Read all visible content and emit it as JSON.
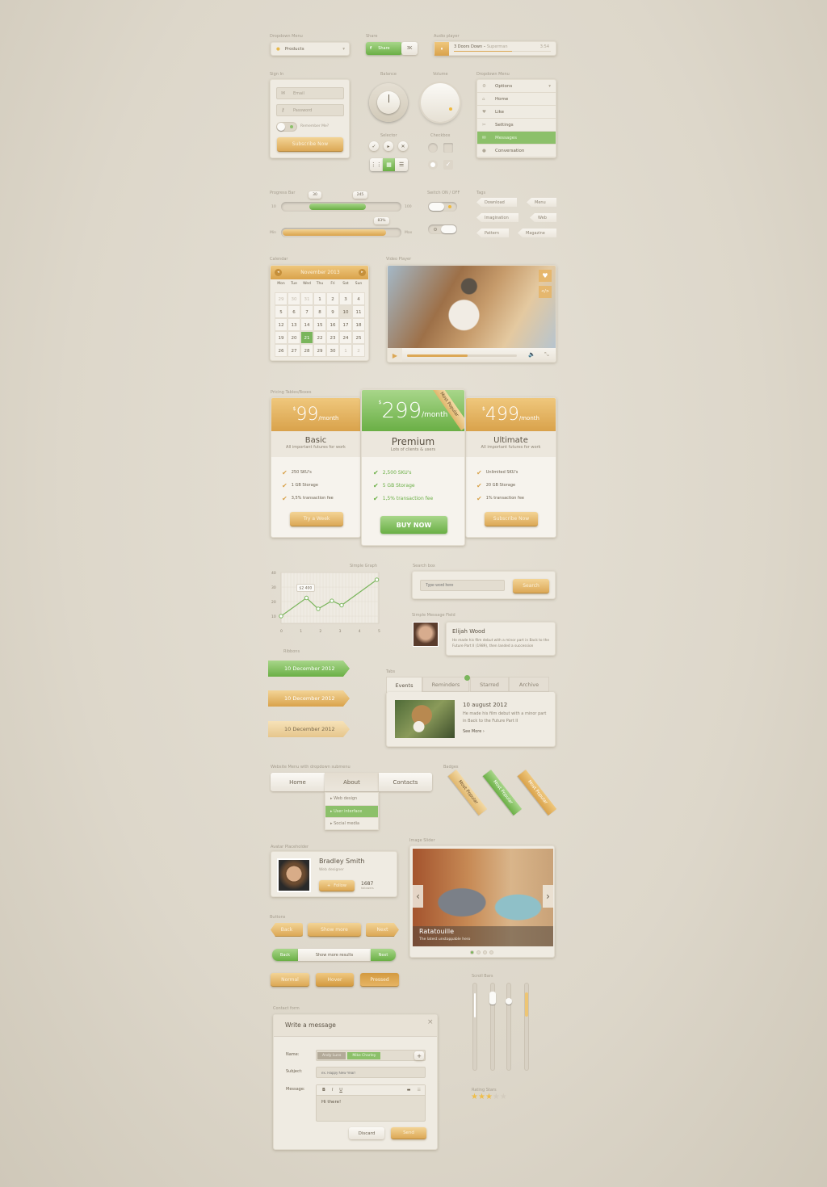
{
  "labels": {
    "dropdown1": "Dropdown Menu",
    "share": "Share",
    "audio": "Audio player",
    "signin": "Sign In",
    "balance": "Balance",
    "volume": "Volume",
    "selector": "Selector",
    "checkbox": "Checkbox",
    "dropdown2": "Dropdown Menu",
    "progress": "Progress Bar",
    "switch": "Switch ON / OFF",
    "tags": "Tags",
    "calendar": "Calendar",
    "video": "Video Player",
    "pricing": "Pricing Tables/Boxes",
    "graph": "Simple Graph",
    "search": "Search box",
    "message": "Simple Message Field",
    "ribbons": "Ribbons",
    "tabs": "Tabs",
    "webmenu": "Website Menu with dropdown submenu",
    "badges": "Badges",
    "avatar": "Avatar Placeholder",
    "slider": "Image Slider",
    "buttons": "Buttons",
    "scrollbars": "Scroll Bars",
    "rating": "Rating Stars",
    "contact": "Contact form"
  },
  "dropdown1": {
    "value": "Products"
  },
  "share": {
    "label": "Share",
    "count": "3K"
  },
  "audio": {
    "artist": "3 Doors Down –",
    "track": "Superman",
    "time": "3:54",
    "progress": 0.6
  },
  "signin": {
    "email_placeholder": "Email",
    "password_placeholder": "Password",
    "remember": "Remember Me?",
    "submit": "Subscribe Now"
  },
  "dropdown2": {
    "items": [
      {
        "label": "Options",
        "icon": "gear-icon"
      },
      {
        "label": "Home",
        "icon": "home-icon"
      },
      {
        "label": "Like",
        "icon": "heart-icon"
      },
      {
        "label": "Settings",
        "icon": "wrench-icon"
      },
      {
        "label": "Messages",
        "icon": "envelope-icon",
        "active": true
      },
      {
        "label": "Conversation",
        "icon": "chat-icon"
      }
    ]
  },
  "progress": {
    "slider": {
      "min": "10",
      "max": "100",
      "low": "30",
      "high": "245"
    },
    "bar": {
      "min": "Min",
      "max": "Max",
      "value": "83%"
    }
  },
  "tags": [
    "Download",
    "Menu",
    "Imagination",
    "Web",
    "Pattern",
    "Magazine"
  ],
  "calendar": {
    "title": "November 2013",
    "days": [
      "Mon",
      "Tue",
      "Wed",
      "Thu",
      "Fri",
      "Sat",
      "Sun"
    ],
    "cells": [
      "29",
      "30",
      "31",
      "1",
      "2",
      "3",
      "4",
      "5",
      "6",
      "7",
      "8",
      "9",
      "10",
      "11",
      "12",
      "13",
      "14",
      "15",
      "16",
      "17",
      "18",
      "19",
      "20",
      "21",
      "22",
      "23",
      "24",
      "25",
      "26",
      "27",
      "28",
      "29",
      "30",
      "1",
      "2"
    ],
    "selected": "21",
    "today": "10"
  },
  "video": {
    "progress": 0.55
  },
  "pricing": [
    {
      "currency": "$",
      "price": "99",
      "period": "/month",
      "name": "Basic",
      "desc": "All important futures for work",
      "features": [
        "250 SKU's",
        "1 GB Storage",
        "3,5% transaction fee"
      ],
      "button": "Try a Week"
    },
    {
      "currency": "$",
      "price": "299",
      "period": "/month",
      "name": "Premium",
      "desc": "Lots of clients & users",
      "features": [
        "2,500 SKU's",
        "5 GB Storage",
        "1,5% transaction fee"
      ],
      "button": "BUY NOW",
      "badge": "Most Popular"
    },
    {
      "currency": "$",
      "price": "499",
      "period": "/month",
      "name": "Ultimate",
      "desc": "All important futures for work",
      "features": [
        "Unlimited SKU's",
        "20 GB Storage",
        "1% transaction fee"
      ],
      "button": "Subscribe Now"
    }
  ],
  "chart_data": {
    "type": "line",
    "title": "Simple Graph",
    "x": [
      0,
      1.3,
      1.9,
      2.6,
      3.1,
      4.9
    ],
    "y": [
      10,
      22.5,
      15,
      20.5,
      17.5,
      35
    ],
    "xticks": [
      "0",
      "1",
      "2",
      "3",
      "4",
      "5"
    ],
    "yticks": [
      "40",
      "30",
      "20",
      "10"
    ],
    "xlim": [
      0,
      5
    ],
    "ylim": [
      5,
      40
    ],
    "annotation": {
      "text": "$2 400",
      "point": 1
    },
    "grid": true,
    "color": "#7ab55c"
  },
  "search": {
    "placeholder": "Type word here",
    "button": "Search"
  },
  "message": {
    "name": "Elijah Wood",
    "text": "He made his film debut with a minor part in Back to the Future Part II (1989), then landed a succession"
  },
  "ribbons": [
    "10 December 2012",
    "10 December 2012",
    "10 December 2012"
  ],
  "tabs": {
    "items": [
      "Events",
      "Reminders",
      "Starred",
      "Archive"
    ],
    "active": 0,
    "title": "10 august 2012",
    "text": "He made his film debut with a minor part in Back to the Future Part II",
    "more": "See More"
  },
  "webmenu": {
    "items": [
      "Home",
      "About",
      "Contacts"
    ],
    "submenu": [
      "Web design",
      "User interface",
      "Social media"
    ],
    "active_sub": 1
  },
  "badges": [
    "Most Popular",
    "Most Popular",
    "Most Popular"
  ],
  "avatar": {
    "name": "Bradley Smith",
    "role": "Web designer",
    "follow": "Follow",
    "count": "1687",
    "count_label": "followers"
  },
  "slider": {
    "title": "Ratatouille",
    "subtitle": "The latest unstoppable hero",
    "slides": 4,
    "active": 0
  },
  "buttons": {
    "back": "Back",
    "more": "Show more",
    "next": "Next",
    "seg": [
      "Back",
      "Show more results",
      "Next"
    ],
    "states": [
      "Normal",
      "Hover",
      "Pressed"
    ]
  },
  "rating": {
    "value": 3,
    "max": 5
  },
  "contact": {
    "title": "Write a message",
    "name_label": "Name:",
    "names": [
      "Andy Luns",
      "Mike Charley"
    ],
    "subject_label": "Subject:",
    "subject_placeholder": "ex. Happy New Year!",
    "message_label": "Message:",
    "message": "Hi there!",
    "toolbar": [
      "B",
      "I",
      "U"
    ],
    "discard": "Discard",
    "send": "Send"
  },
  "colors": {
    "orange": "#dca856",
    "green": "#7ab55c",
    "bg": "#e0dbd0"
  }
}
